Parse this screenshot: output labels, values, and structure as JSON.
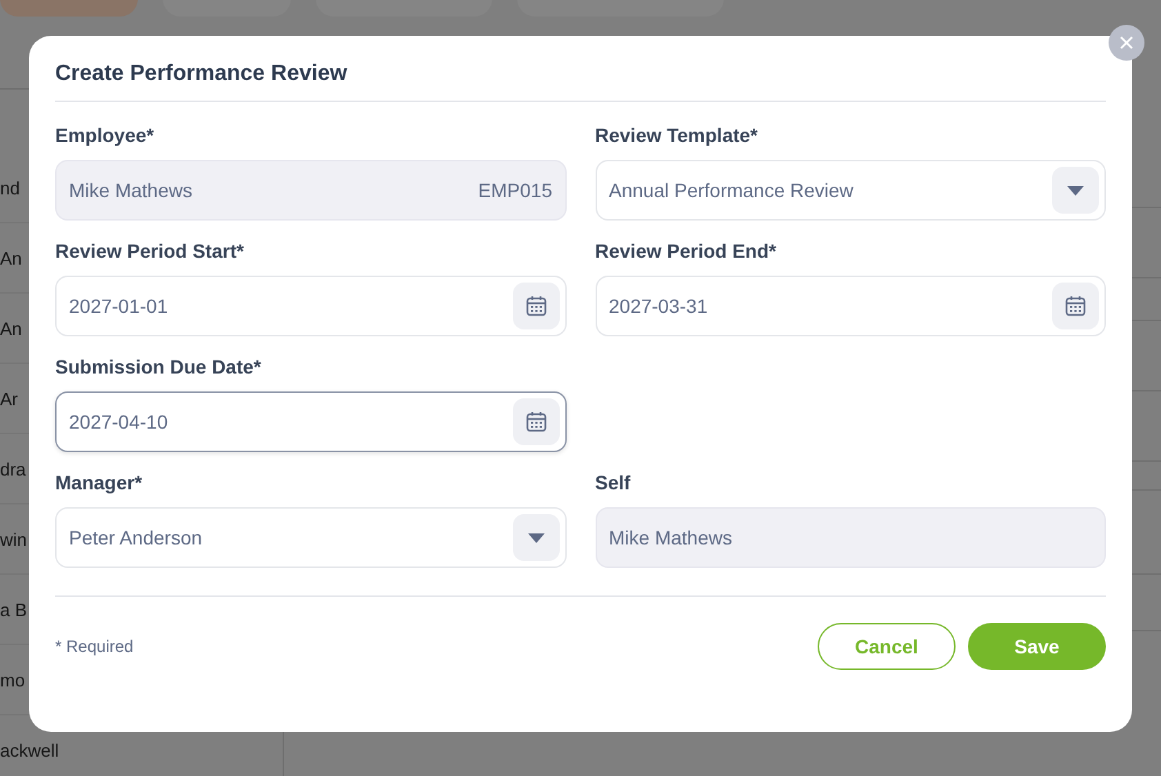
{
  "background": {
    "tabs": [
      {
        "selected": true
      },
      {
        "selected": false
      },
      {
        "selected": false
      },
      {
        "selected": false
      }
    ],
    "list": [
      "nd",
      "An",
      "An",
      "Ar",
      "dra",
      "win",
      "a B",
      "mo",
      "ackwell"
    ]
  },
  "dialog": {
    "title": "Create Performance Review",
    "rows": [
      [
        {
          "kind": "readonly",
          "label": "Employee*",
          "value": "Mike Mathews",
          "code": "EMP015"
        },
        {
          "kind": "select",
          "label": "Review Template*",
          "value": "Annual Performance Review"
        }
      ],
      [
        {
          "kind": "date",
          "label": "Review Period Start*",
          "value": "2027-01-01",
          "focused": false
        },
        {
          "kind": "date",
          "label": "Review Period End*",
          "value": "2027-03-31",
          "focused": false
        }
      ],
      [
        {
          "kind": "date",
          "label": "Submission Due Date*",
          "value": "2027-04-10",
          "focused": true
        }
      ],
      [
        {
          "kind": "select",
          "label": "Manager*",
          "value": "Peter Anderson"
        },
        {
          "kind": "readonly",
          "label": "Self",
          "value": "Mike Mathews"
        }
      ]
    ],
    "note": "* Required",
    "buttons": [
      {
        "kind": "secondary",
        "label": "Cancel"
      },
      {
        "kind": "primary",
        "label": "Save"
      }
    ]
  }
}
